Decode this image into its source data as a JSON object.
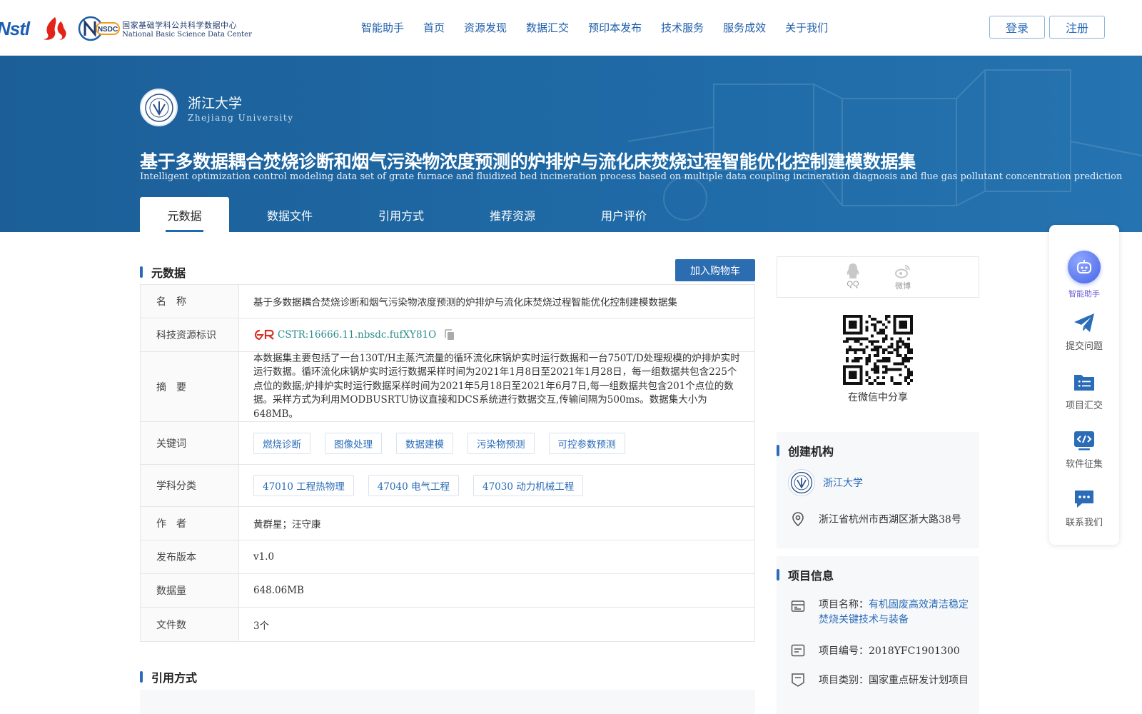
{
  "header": {
    "logo_nstl": "Nstl",
    "nsdc_logo_letters": "NSDC",
    "nsdc_name_cn": "国家基础学科公共科学数据中心",
    "nsdc_name_en": "National Basic Science Data Center",
    "nav": [
      "智能助手",
      "首页",
      "资源发现",
      "数据汇交",
      "预印本发布",
      "技术服务",
      "服务成效",
      "关于我们"
    ],
    "login": "登录",
    "register": "注册"
  },
  "hero": {
    "institution_cn": "浙江大学",
    "institution_en": "Zhejiang University",
    "title": "基于多数据耦合焚烧诊断和烟气污染物浓度预测的炉排炉与流化床焚烧过程智能优化控制建模数据集",
    "subtitle": "Intelligent optimization control modeling data set of grate furnace and fluidized bed incineration process based on multiple data coupling incineration diagnosis and flue gas pollutant concentration prediction",
    "tabs": [
      "元数据",
      "数据文件",
      "引用方式",
      "推荐资源",
      "用户评价"
    ],
    "active_tab": 0
  },
  "metadata": {
    "section_title": "元数据",
    "cart_button": "加入购物车",
    "rows": {
      "name": {
        "label": "名　称",
        "value": "基于多数据耦合焚烧诊断和烟气污染物浓度预测的炉排炉与流化床焚烧过程智能优化控制建模数据集"
      },
      "identifier": {
        "label": "科技资源标识",
        "value": "CSTR:16666.11.nbsdc.fufXY81O"
      },
      "abstract": {
        "label": "摘　要",
        "value": "本数据集主要包括了一台130T/H主蒸汽流量的循环流化床锅炉实时运行数据和一台750T/D处理规模的炉排炉实时运行数据。循环流化床锅炉实时运行数据采样时间为2021年1月8日至2021年1月28日，每一组数据共包含225个点位的数据;炉排炉实时运行数据采样时间为2021年5月18日至2021年6月7日,每一组数据共包含201个点位的数据。采样方式为利用MODBUSRTU协议直接和DCS系统进行数据交互,传输间隔为500ms。数据集大小为648MB。"
      },
      "keywords": {
        "label": "关键词",
        "values": [
          "燃烧诊断",
          "图像处理",
          "数据建模",
          "污染物预测",
          "可控参数预测"
        ]
      },
      "subjects": {
        "label": "学科分类",
        "values": [
          "47010 工程热物理",
          "47040 电气工程",
          "47030 动力机械工程"
        ]
      },
      "authors": {
        "label": "作　者",
        "value": "黄群星；汪守康"
      },
      "version": {
        "label": "发布版本",
        "value": "v1.0"
      },
      "size": {
        "label": "数据量",
        "value": "648.06MB"
      },
      "files": {
        "label": "文件数",
        "value": "3个"
      }
    }
  },
  "citation": {
    "section_title": "引用方式"
  },
  "share": {
    "qq": "QQ",
    "weibo": "微博",
    "wechat": "在微信中分享"
  },
  "org": {
    "section_title": "创建机构",
    "name": "浙江大学",
    "address": "浙江省杭州市西湖区浙大路38号"
  },
  "project": {
    "section_title": "项目信息",
    "name_label": "项目名称：",
    "name_value": "有机固废高效清洁稳定焚烧关键技术与装备",
    "code_label": "项目编号：",
    "code_value": "2018YFC1901300",
    "type_label": "项目类别：",
    "type_value": "国家重点研发计划项目"
  },
  "floatbar": {
    "items": [
      "智能助手",
      "提交问题",
      "项目汇交",
      "软件征集",
      "联系我们"
    ]
  },
  "colors": {
    "primary": "#2a6cb8",
    "hero_bg": "#1f6aa6",
    "identifier_text": "#2a8c8a",
    "cstr_red": "#d93025",
    "assistant_accent": "#6b5cd6"
  }
}
